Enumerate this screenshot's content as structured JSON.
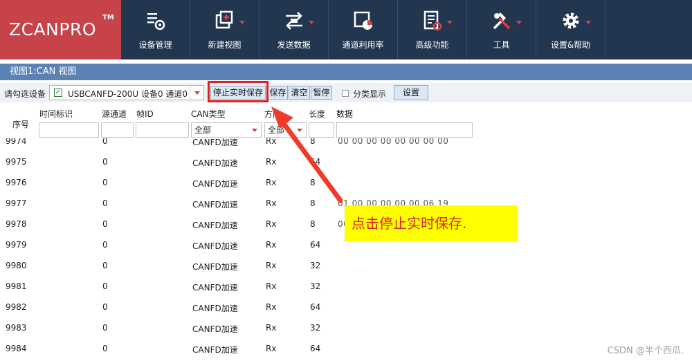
{
  "app": {
    "logo": "ZCANPRO",
    "tm": "TM"
  },
  "toolbar": [
    {
      "label": "设备管理",
      "icon": "device-settings-icon",
      "dropdown": false
    },
    {
      "label": "新建视图",
      "icon": "new-view-icon",
      "dropdown": true
    },
    {
      "label": "发送数据",
      "icon": "send-data-icon",
      "dropdown": true
    },
    {
      "label": "通道利用率",
      "icon": "channel-usage-icon",
      "dropdown": false
    },
    {
      "label": "高级功能",
      "icon": "advanced-features-icon",
      "dropdown": true
    },
    {
      "label": "工具",
      "icon": "tools-icon",
      "dropdown": true
    },
    {
      "label": "设置&帮助",
      "icon": "settings-gear-icon",
      "dropdown": true
    }
  ],
  "view": {
    "title": "视图1:CAN 视图"
  },
  "controls": {
    "device_label": "请勾选设备",
    "device_value": "USBCANFD-200U 设备0 通道0",
    "stop_save_label": "停止实时保存",
    "save_label": "保存",
    "clear_label": "清空",
    "pause_label": "暂停",
    "classify_label": "分类显示",
    "settings_label": "设置"
  },
  "grid": {
    "headers": {
      "seq": "序号",
      "time": "时间标识",
      "channel": "源通道",
      "frame_id": "帧ID",
      "can_type": "CAN类型",
      "direction": "方向",
      "length": "长度",
      "data": "数据"
    },
    "filters": {
      "can_type": "全部",
      "direction": "全部"
    },
    "rows": [
      {
        "seq": "9974",
        "channel": "0",
        "type": "CANFD加速",
        "dir": "Rx",
        "len": "8",
        "data": "00 00 00 00 00 00 00 00"
      },
      {
        "seq": "9975",
        "channel": "0",
        "type": "CANFD加速",
        "dir": "Rx",
        "len": "64",
        "data": ""
      },
      {
        "seq": "9976",
        "channel": "0",
        "type": "CANFD加速",
        "dir": "Rx",
        "len": "8",
        "data": ""
      },
      {
        "seq": "9977",
        "channel": "0",
        "type": "CANFD加速",
        "dir": "Rx",
        "len": "8",
        "data": "01 00 00 00 00 00 06 19"
      },
      {
        "seq": "9978",
        "channel": "0",
        "type": "CANFD加速",
        "dir": "Rx",
        "len": "8",
        "data": "00"
      },
      {
        "seq": "9979",
        "channel": "0",
        "type": "CANFD加速",
        "dir": "Rx",
        "len": "64",
        "data": ""
      },
      {
        "seq": "9980",
        "channel": "0",
        "type": "CANFD加速",
        "dir": "Rx",
        "len": "32",
        "data": ""
      },
      {
        "seq": "9981",
        "channel": "0",
        "type": "CANFD加速",
        "dir": "Rx",
        "len": "32",
        "data": ""
      },
      {
        "seq": "9982",
        "channel": "0",
        "type": "CANFD加速",
        "dir": "Rx",
        "len": "64",
        "data": ""
      },
      {
        "seq": "9983",
        "channel": "0",
        "type": "CANFD加速",
        "dir": "Rx",
        "len": "32",
        "data": ""
      },
      {
        "seq": "9984",
        "channel": "0",
        "type": "CANFD加速",
        "dir": "Rx",
        "len": "64",
        "data": ""
      }
    ]
  },
  "annotation": {
    "text": "点击停止实时保存.",
    "color": "#e02020",
    "bg": "#ffff00"
  },
  "watermark": "CSDN @半个西瓜."
}
